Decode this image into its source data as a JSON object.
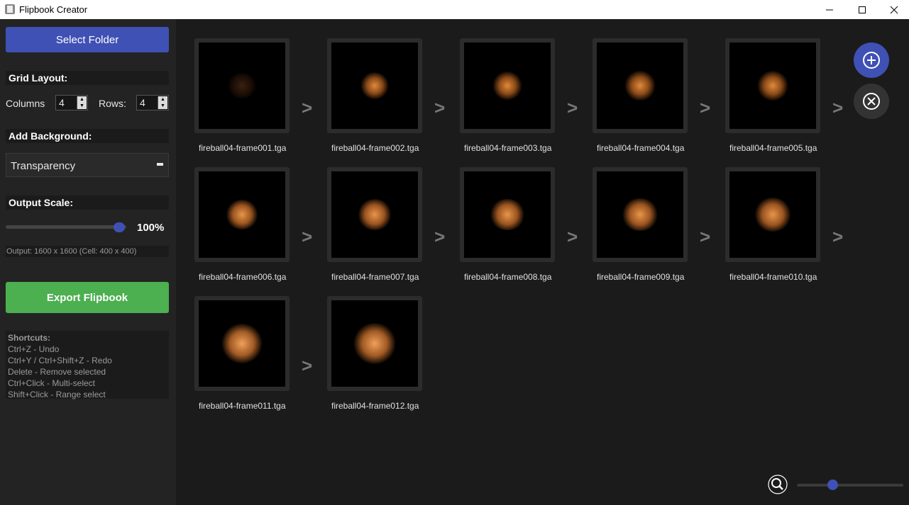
{
  "window": {
    "title": "Flipbook Creator"
  },
  "sidebar": {
    "select_folder": "Select Folder",
    "grid_layout_title": "Grid Layout:",
    "columns_label": "Columns",
    "columns_value": "4",
    "rows_label": "Rows:",
    "rows_value": "4",
    "background_title": "Add Background:",
    "background_selected": "Transparency",
    "scale_title": "Output Scale:",
    "scale_value": "100%",
    "scale_level": 1.0,
    "output_info": "Output: 1600 x 1600 (Cell: 400 x 400)",
    "export_label": "Export Flipbook",
    "shortcuts": {
      "title": "Shortcuts:",
      "items": [
        "Ctrl+Z - Undo",
        "Ctrl+Y / Ctrl+Shift+Z - Redo",
        "Delete - Remove selected",
        "Ctrl+Click - Multi-select",
        "Shift+Click - Range select"
      ]
    }
  },
  "frames": [
    "fireball04-frame001.tga",
    "fireball04-frame002.tga",
    "fireball04-frame003.tga",
    "fireball04-frame004.tga",
    "fireball04-frame005.tga",
    "fireball04-frame006.tga",
    "fireball04-frame007.tga",
    "fireball04-frame008.tga",
    "fireball04-frame009.tga",
    "fireball04-frame010.tga",
    "fireball04-frame011.tga",
    "fireball04-frame012.tga"
  ],
  "arrow_glyph": ">",
  "zoom_level": 0.35,
  "colors": {
    "accent": "#3f51b5",
    "export": "#4caf50",
    "fire": "#e08a3a"
  }
}
